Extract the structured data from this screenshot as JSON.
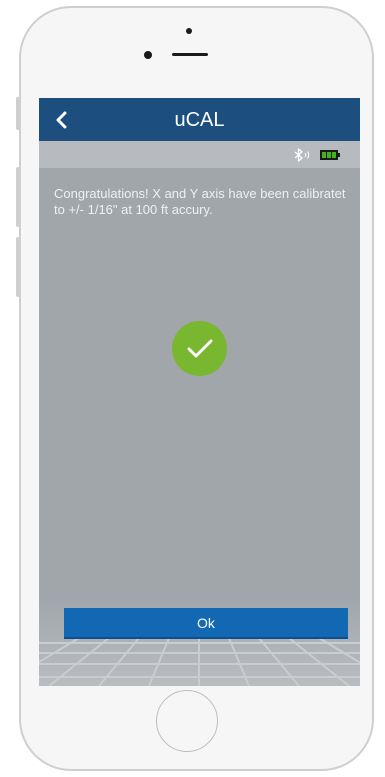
{
  "header": {
    "back_icon": "chevron-left-icon",
    "title": "uCAL"
  },
  "status": {
    "bluetooth_icon": "bluetooth-icon",
    "battery_icon": "battery-icon",
    "battery_color": "#3fb51b"
  },
  "content": {
    "message": "Congratulations! X and Y axis have been calibratet to +/- 1/16\" at 100 ft accury.",
    "success_icon": "checkmark-icon",
    "success_color": "#7ab730"
  },
  "actions": {
    "ok_label": "Ok"
  },
  "colors": {
    "header_bg": "#1d4f7e",
    "screen_bg": "#a1a6ab",
    "button_bg": "#1368b4"
  }
}
